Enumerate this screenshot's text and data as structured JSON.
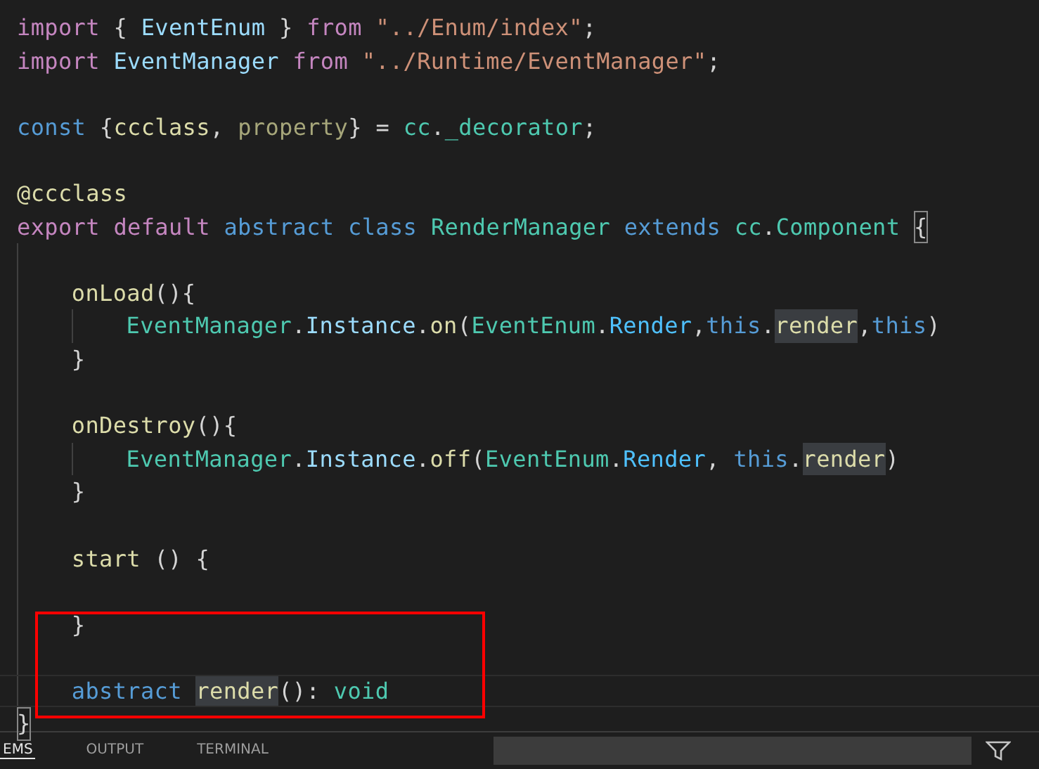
{
  "editor": {
    "annotation": {
      "kind": "rectangle",
      "color": "#ff0000"
    },
    "lines": [
      {
        "kind": "code",
        "current": false,
        "boxed": false,
        "tokens": [
          {
            "text": "import ",
            "kind": "keyword"
          },
          {
            "text": "{ ",
            "kind": "plain"
          },
          {
            "text": "EventEnum",
            "kind": "variable"
          },
          {
            "text": " } ",
            "kind": "plain"
          },
          {
            "text": "from ",
            "kind": "keyword"
          },
          {
            "text": "\"../Enum/index\"",
            "kind": "string"
          },
          {
            "text": ";",
            "kind": "plain"
          }
        ]
      },
      {
        "kind": "code",
        "current": false,
        "boxed": false,
        "tokens": [
          {
            "text": "import ",
            "kind": "keyword"
          },
          {
            "text": "EventManager ",
            "kind": "variable"
          },
          {
            "text": "from ",
            "kind": "keyword"
          },
          {
            "text": "\"../Runtime/EventManager\"",
            "kind": "string"
          },
          {
            "text": ";",
            "kind": "plain"
          }
        ]
      },
      {
        "kind": "blank",
        "current": false,
        "boxed": false
      },
      {
        "kind": "code",
        "current": false,
        "boxed": false,
        "tokens": [
          {
            "text": "const ",
            "kind": "storage"
          },
          {
            "text": "{",
            "kind": "plain"
          },
          {
            "text": "ccclass",
            "kind": "function"
          },
          {
            "text": ", ",
            "kind": "plain"
          },
          {
            "text": "property",
            "kind": "unused"
          },
          {
            "text": "} = ",
            "kind": "plain"
          },
          {
            "text": "cc",
            "kind": "type"
          },
          {
            "text": ".",
            "kind": "plain"
          },
          {
            "text": "_decorator",
            "kind": "type"
          },
          {
            "text": ";",
            "kind": "plain"
          }
        ]
      },
      {
        "kind": "blank",
        "current": false,
        "boxed": false
      },
      {
        "kind": "code",
        "current": false,
        "boxed": false,
        "tokens": [
          {
            "text": "@ccclass",
            "kind": "function"
          }
        ]
      },
      {
        "kind": "code",
        "current": false,
        "boxed": false,
        "tokens": [
          {
            "text": "export ",
            "kind": "keyword"
          },
          {
            "text": "default ",
            "kind": "keyword"
          },
          {
            "text": "abstract ",
            "kind": "storage"
          },
          {
            "text": "class ",
            "kind": "storage"
          },
          {
            "text": "RenderManager ",
            "kind": "type"
          },
          {
            "text": "extends ",
            "kind": "storage"
          },
          {
            "text": "cc",
            "kind": "type"
          },
          {
            "text": ".",
            "kind": "plain"
          },
          {
            "text": "Component ",
            "kind": "type"
          },
          {
            "text": "{",
            "kind": "bracket-match"
          }
        ],
        "children": [
          {
            "kind": "blank",
            "current": false,
            "boxed": false
          },
          {
            "kind": "code",
            "current": false,
            "boxed": false,
            "tokens": [
              {
                "text": "onLoad",
                "kind": "function"
              },
              {
                "text": "(){",
                "kind": "plain"
              }
            ],
            "children": [
              {
                "kind": "code",
                "current": false,
                "boxed": false,
                "tokens": [
                  {
                    "text": "EventManager",
                    "kind": "type"
                  },
                  {
                    "text": ".",
                    "kind": "plain"
                  },
                  {
                    "text": "Instance",
                    "kind": "variable"
                  },
                  {
                    "text": ".",
                    "kind": "plain"
                  },
                  {
                    "text": "on",
                    "kind": "function"
                  },
                  {
                    "text": "(",
                    "kind": "plain"
                  },
                  {
                    "text": "EventEnum",
                    "kind": "type"
                  },
                  {
                    "text": ".",
                    "kind": "plain"
                  },
                  {
                    "text": "Render",
                    "kind": "enum"
                  },
                  {
                    "text": ",",
                    "kind": "plain"
                  },
                  {
                    "text": "this",
                    "kind": "storage"
                  },
                  {
                    "text": ".",
                    "kind": "plain"
                  },
                  {
                    "text": "render",
                    "kind": "match"
                  },
                  {
                    "text": ",",
                    "kind": "plain"
                  },
                  {
                    "text": "this",
                    "kind": "storage"
                  },
                  {
                    "text": ")",
                    "kind": "plain"
                  }
                ]
              }
            ]
          },
          {
            "kind": "code",
            "current": false,
            "boxed": false,
            "tokens": [
              {
                "text": "}",
                "kind": "plain"
              }
            ]
          },
          {
            "kind": "blank",
            "current": false,
            "boxed": false
          },
          {
            "kind": "code",
            "current": false,
            "boxed": false,
            "tokens": [
              {
                "text": "onDestroy",
                "kind": "function"
              },
              {
                "text": "(){",
                "kind": "plain"
              }
            ],
            "children": [
              {
                "kind": "code",
                "current": false,
                "boxed": false,
                "tokens": [
                  {
                    "text": "EventManager",
                    "kind": "type"
                  },
                  {
                    "text": ".",
                    "kind": "plain"
                  },
                  {
                    "text": "Instance",
                    "kind": "variable"
                  },
                  {
                    "text": ".",
                    "kind": "plain"
                  },
                  {
                    "text": "off",
                    "kind": "function"
                  },
                  {
                    "text": "(",
                    "kind": "plain"
                  },
                  {
                    "text": "EventEnum",
                    "kind": "type"
                  },
                  {
                    "text": ".",
                    "kind": "plain"
                  },
                  {
                    "text": "Render",
                    "kind": "enum"
                  },
                  {
                    "text": ", ",
                    "kind": "plain"
                  },
                  {
                    "text": "this",
                    "kind": "storage"
                  },
                  {
                    "text": ".",
                    "kind": "plain"
                  },
                  {
                    "text": "render",
                    "kind": "match"
                  },
                  {
                    "text": ")",
                    "kind": "plain"
                  }
                ]
              }
            ]
          },
          {
            "kind": "code",
            "current": false,
            "boxed": false,
            "tokens": [
              {
                "text": "}",
                "kind": "plain"
              }
            ]
          },
          {
            "kind": "blank",
            "current": false,
            "boxed": false
          },
          {
            "kind": "code",
            "current": false,
            "boxed": false,
            "tokens": [
              {
                "text": "start",
                "kind": "function"
              },
              {
                "text": " () {",
                "kind": "plain"
              }
            ]
          },
          {
            "kind": "blank",
            "current": false,
            "boxed": false
          },
          {
            "kind": "code",
            "current": false,
            "boxed": true,
            "tokens": [
              {
                "text": "}",
                "kind": "plain"
              }
            ]
          },
          {
            "kind": "blank",
            "current": false,
            "boxed": true
          },
          {
            "kind": "code",
            "current": true,
            "boxed": true,
            "tokens": [
              {
                "text": "abstract ",
                "kind": "storage"
              },
              {
                "text": "render",
                "kind": "match"
              },
              {
                "text": "(): ",
                "kind": "plain"
              },
              {
                "text": "void",
                "kind": "type"
              }
            ]
          }
        ]
      },
      {
        "kind": "code",
        "current": false,
        "boxed": false,
        "tokens": [
          {
            "text": "}",
            "kind": "bracket-match"
          }
        ]
      }
    ]
  },
  "panel": {
    "tabs": [
      {
        "label": "EMS",
        "selected": true
      },
      {
        "label": "OUTPUT",
        "selected": false
      },
      {
        "label": "TERMINAL",
        "selected": false
      }
    ]
  }
}
